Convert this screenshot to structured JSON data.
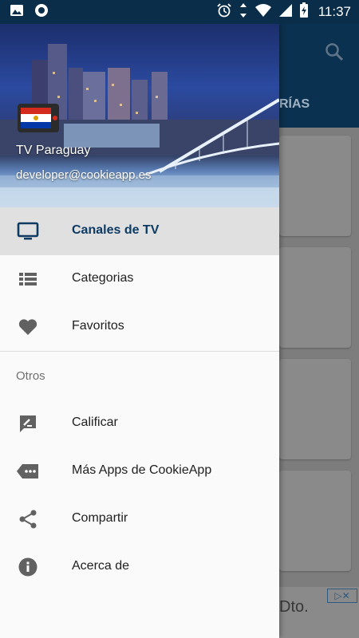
{
  "status_bar": {
    "time": "11:37",
    "icons": [
      "image-icon",
      "circle-app-icon",
      "alarm-icon",
      "data-arrows-icon",
      "wifi-icon",
      "signal-icon",
      "battery-charging-icon"
    ]
  },
  "drawer_header": {
    "app_name": "TV Paraguay",
    "email": "developer@cookieapp.es",
    "avatar_icon": "paraguay-flag-tv-icon"
  },
  "menu": {
    "items": [
      {
        "label": "Canales de TV",
        "icon": "tv-icon",
        "active": true
      },
      {
        "label": "Categorias",
        "icon": "list-icon",
        "active": false
      },
      {
        "label": "Favoritos",
        "icon": "heart-icon",
        "active": false
      }
    ],
    "section_label": "Otros",
    "other_items": [
      {
        "label": "Calificar",
        "icon": "rate-review-icon"
      },
      {
        "label": "Más Apps de CookieApp",
        "icon": "more-apps-icon"
      },
      {
        "label": "Compartir",
        "icon": "share-icon"
      },
      {
        "label": "Acerca de",
        "icon": "info-icon"
      }
    ]
  },
  "background": {
    "tab_label_partial": "RÍAS",
    "ad_text_partial": "Dto.",
    "ad_badge": "▷✕"
  },
  "colors": {
    "app_bar": "#0b3150",
    "active_text": "#0d3a63",
    "icon": "#616161",
    "tv_icon": "#0d3a63"
  }
}
